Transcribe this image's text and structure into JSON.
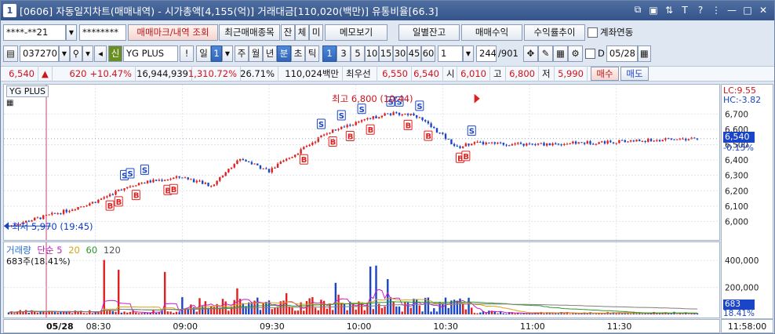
{
  "window": {
    "number": "1",
    "title": "[0606] 자동일지차트(매매내역) - 시가총액[4,155(억)] 거래대금[110,020(백만)] 유통비율[66.3]"
  },
  "toolbar1": {
    "account": "****-**21",
    "password": "********",
    "btn_trade_mark": "매매마크/내역 조회",
    "btn_recent": "최근매매종목",
    "btn_jan": "잔",
    "btn_che": "체",
    "btn_mi": "미",
    "btn_memo": "메모보기",
    "btn_daily": "일별잔고",
    "btn_profit": "매매수익",
    "btn_return": "수익률추이",
    "account_link_label": "계좌연동"
  },
  "toolbar2": {
    "code": "037270",
    "badge": "신",
    "name": "YG PLUS",
    "excl": "!",
    "period": "일",
    "period_num": "1",
    "ju": "주",
    "wol": "월",
    "nyeon": "년",
    "bun": "분",
    "cho": "초",
    "tik": "틱",
    "intervals": [
      "1",
      "3",
      "5",
      "10",
      "15",
      "30",
      "45",
      "60"
    ],
    "interval_input": "1",
    "count": "244",
    "count_total": "/901",
    "check_d": "D",
    "date": "05/28"
  },
  "quote": {
    "price": "6,540",
    "arrow": "▲",
    "change": "620",
    "change_pct": "+10.47%",
    "volume": "16,944,939",
    "volume_pct": "1,310.72%",
    "turnover": "26.71%",
    "amount": "110,024백만",
    "best_label": "최우선",
    "best_ask": "6,550",
    "best_bid": "6,540",
    "open_label": "시",
    "open": "6,010",
    "high_label": "고",
    "high": "6,800",
    "low_label": "저",
    "low": "5,990",
    "buy": "매수",
    "sell": "매도"
  },
  "chart": {
    "stock_label": "YG PLUS",
    "high_note": "최고 6,800 (10:44)",
    "low_note": "최저 5,970 (19:45)",
    "lc": "LC:9.55",
    "hc": "HC:-3.82",
    "current_tag": "6,540",
    "current_pct": "-0.15%",
    "vol_title": "거래량",
    "vol_ma_label": "단순",
    "vol_ma": [
      "5",
      "20",
      "60",
      "120"
    ],
    "vol_note": "683주(18.41%)",
    "vol_tag": "683",
    "vol_tag_pct": "18.41%",
    "date_label": "05/28",
    "end_time": "11:58:00",
    "time_ticks": [
      "08:30",
      "09:00",
      "09:30",
      "10:00",
      "10:30",
      "11:00",
      "11:30"
    ],
    "price_ticks": [
      "6,700",
      "6,600",
      "6,500",
      "6,400",
      "6,300",
      "6,200",
      "6,100",
      "6,000"
    ],
    "vol_ticks": [
      "400,000",
      "200,000"
    ],
    "colors": {
      "up": "#e0201e",
      "down": "#1b45c8",
      "ma5": "#c81ec8",
      "ma20": "#d5a418",
      "ma60": "#2a9a2a",
      "ma120": "#7f7f7f"
    }
  },
  "chart_data": {
    "type": "candlestick",
    "x_range": [
      "08:00",
      "11:58"
    ],
    "ylim": [
      5900,
      6850
    ],
    "price_anchors": [
      [
        "08:00",
        5970
      ],
      [
        "08:10",
        6020
      ],
      [
        "08:20",
        6070
      ],
      [
        "08:30",
        6130
      ],
      [
        "08:40",
        6220
      ],
      [
        "08:45",
        6250
      ],
      [
        "09:00",
        6290
      ],
      [
        "09:10",
        6230
      ],
      [
        "09:20",
        6410
      ],
      [
        "09:30",
        6330
      ],
      [
        "09:40",
        6450
      ],
      [
        "09:50",
        6580
      ],
      [
        "10:00",
        6640
      ],
      [
        "10:10",
        6700
      ],
      [
        "10:20",
        6700
      ],
      [
        "10:30",
        6560
      ],
      [
        "10:35",
        6480
      ],
      [
        "10:40",
        6510
      ],
      [
        "11:00",
        6500
      ],
      [
        "11:30",
        6520
      ],
      [
        "11:58",
        6540
      ]
    ],
    "volume_ylim": [
      0,
      500000
    ]
  }
}
